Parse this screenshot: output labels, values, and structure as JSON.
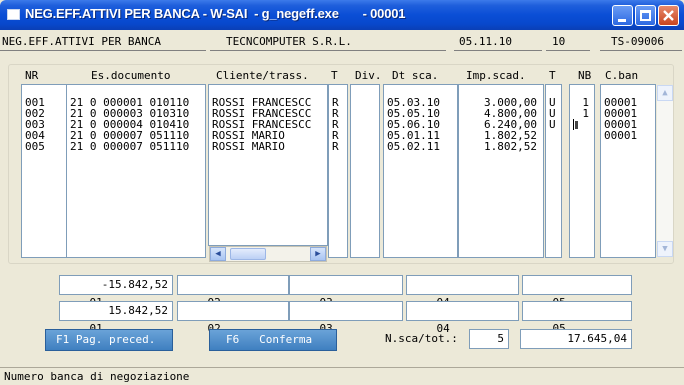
{
  "window": {
    "title": "NEG.EFF.ATTIVI PER BANCA - W-SAI  - g_negeff.exe       - 00001",
    "controls": {
      "minimize": "minimize-icon",
      "maximize": "maximize-icon",
      "close": "close-icon"
    }
  },
  "header": {
    "left": "NEG.EFF.ATTIVI PER BANCA",
    "company": "TECNCOMPUTER S.R.L.",
    "date": "05.11.10",
    "code": "10",
    "terminal": "TS-09006"
  },
  "table": {
    "headers": {
      "nr": "NR",
      "es_documento": "Es.documento",
      "cliente": "Cliente/trass.",
      "t": "T",
      "div": "Div.",
      "dt_sca": "Dt sca.",
      "imp_scad": "Imp.scad.",
      "t2": "T",
      "nb": "NB",
      "cban": "C.ban"
    },
    "rows": [
      {
        "nr": "001",
        "doc": "21 0 000001 010110",
        "cliente": "ROSSI FRANCESCC",
        "t": "R",
        "div": "",
        "dt": "05.03.10",
        "imp": "3.000,00",
        "t2": "U",
        "nb": "1",
        "cban": "00001"
      },
      {
        "nr": "002",
        "doc": "21 0 000003 010310",
        "cliente": "ROSSI FRANCESCC",
        "t": "R",
        "div": "",
        "dt": "05.05.10",
        "imp": "4.800,00",
        "t2": "U",
        "nb": "1",
        "cban": "00001"
      },
      {
        "nr": "003",
        "doc": "21 0 000004 010410",
        "cliente": "ROSSI FRANCESCC",
        "t": "R",
        "div": "",
        "dt": "05.06.10",
        "imp": "6.240,00",
        "t2": "U",
        "nb": "1",
        "cban": "00001"
      },
      {
        "nr": "004",
        "doc": "21 0 000007 051110",
        "cliente": "ROSSI MARIO",
        "t": "R",
        "div": "",
        "dt": "05.01.11",
        "imp": "1.802,52",
        "t2": "",
        "nb": "",
        "cban": "00001"
      },
      {
        "nr": "005",
        "doc": "21 0 000007 051110",
        "cliente": "ROSSI MARIO",
        "t": "R",
        "div": "",
        "dt": "05.02.11",
        "imp": "1.802,52",
        "t2": "",
        "nb": "",
        "cban": ""
      }
    ]
  },
  "totals": {
    "row1": [
      {
        "code": "01",
        "value": "-15.842,52"
      },
      {
        "code": "02",
        "value": ""
      },
      {
        "code": "03",
        "value": ""
      },
      {
        "code": "04",
        "value": ""
      },
      {
        "code": "05",
        "value": ""
      }
    ],
    "row2": [
      {
        "code": "01",
        "value": "15.842,52"
      },
      {
        "code": "02",
        "value": ""
      },
      {
        "code": "03",
        "value": ""
      },
      {
        "code": "04",
        "value": ""
      },
      {
        "code": "05",
        "value": ""
      }
    ]
  },
  "buttons": {
    "prev": "F1 Pag. preced.",
    "confirm": "F6   Conferma"
  },
  "nsca": {
    "label": "N.sca/tot.:",
    "value": "5",
    "total": "17.645,04"
  },
  "status": "Numero banca di negoziazione"
}
